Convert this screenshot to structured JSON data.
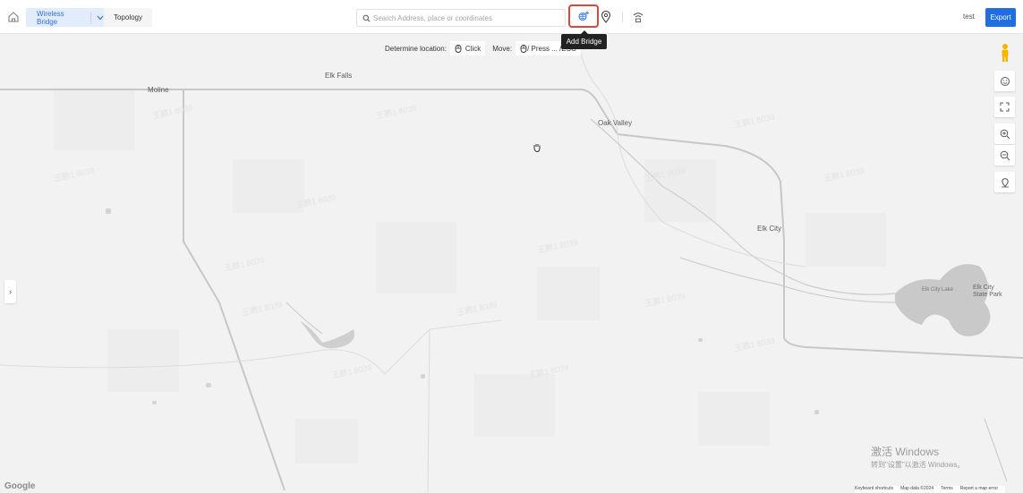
{
  "header": {
    "home_icon": "home-icon",
    "tabs": [
      {
        "label": "Wireless Bridge",
        "active": true
      },
      {
        "label": "Topology",
        "active": false
      }
    ],
    "search": {
      "placeholder": "Search Address, place or coordinates",
      "value": ""
    },
    "tools": {
      "add_bridge_icon": "add-bridge-icon",
      "location_icon": "location-pin-icon",
      "signal_icon": "wifi-signal-icon"
    },
    "user_name": "test",
    "export_label": "Export",
    "accent_color": "#1f6fe3",
    "highlight_color": "#e0443a"
  },
  "tooltip": {
    "text": "Add Bridge"
  },
  "map_hint": {
    "determine_label": "Determine location:",
    "click_label": "Click",
    "move_label": "Move:",
    "move_text": "/ Press ... /ESC"
  },
  "map": {
    "places": [
      "Moline",
      "Elk Falls",
      "Oak Valley",
      "Elk City",
      "Elk City Lake",
      "Elk City State Park"
    ],
    "watermark": "王鹏1 8039",
    "controls": [
      "pegman-icon",
      "face-icon",
      "fullscreen-icon",
      "zoom-in-icon",
      "zoom-out-icon",
      "locate-icon"
    ]
  },
  "windows_notice": {
    "line1": "激活 Windows",
    "line2": "转到\"设置\"以激活 Windows。"
  },
  "footer": {
    "logo": "Google",
    "items": [
      "Keyboard shortcuts",
      "Map data ©2024",
      "Terms",
      "Report a map error"
    ]
  }
}
